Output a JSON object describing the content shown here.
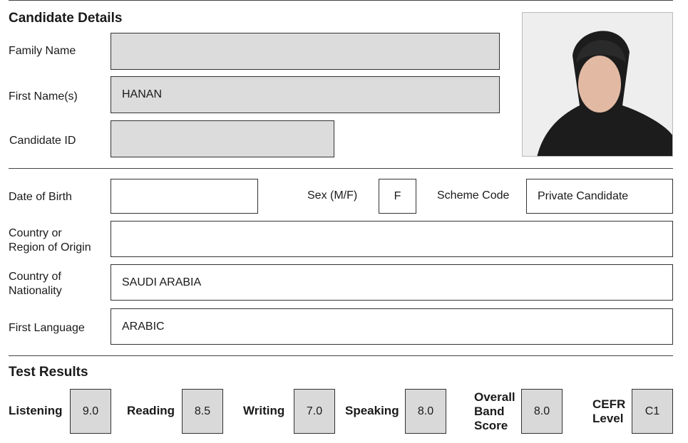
{
  "section_candidate": "Candidate Details",
  "labels": {
    "family_name": "Family Name",
    "first_names": "First Name(s)",
    "candidate_id": "Candidate ID",
    "dob": "Date of Birth",
    "sex": "Sex (M/F)",
    "scheme_code": "Scheme Code",
    "country_origin_1": "Country or",
    "country_origin_2": "Region of Origin",
    "nationality_1": "Country of",
    "nationality_2": "Nationality",
    "first_language": "First Language"
  },
  "values": {
    "family_name": "",
    "first_names": "HANAN",
    "candidate_id": "",
    "dob": "",
    "sex": "F",
    "scheme_code": "Private Candidate",
    "country_origin": "",
    "nationality": "SAUDI ARABIA",
    "first_language": "ARABIC"
  },
  "section_results": "Test Results",
  "scores": {
    "listening_label": "Listening",
    "listening": "9.0",
    "reading_label": "Reading",
    "reading": "8.5",
    "writing_label": "Writing",
    "writing": "7.0",
    "speaking_label": "Speaking",
    "speaking": "8.0",
    "overall_1": "Overall",
    "overall_2": "Band",
    "overall_3": "Score",
    "overall": "8.0",
    "cefr_1": "CEFR",
    "cefr_2": "Level",
    "cefr": "C1"
  },
  "photo_icon": "candidate-photo"
}
